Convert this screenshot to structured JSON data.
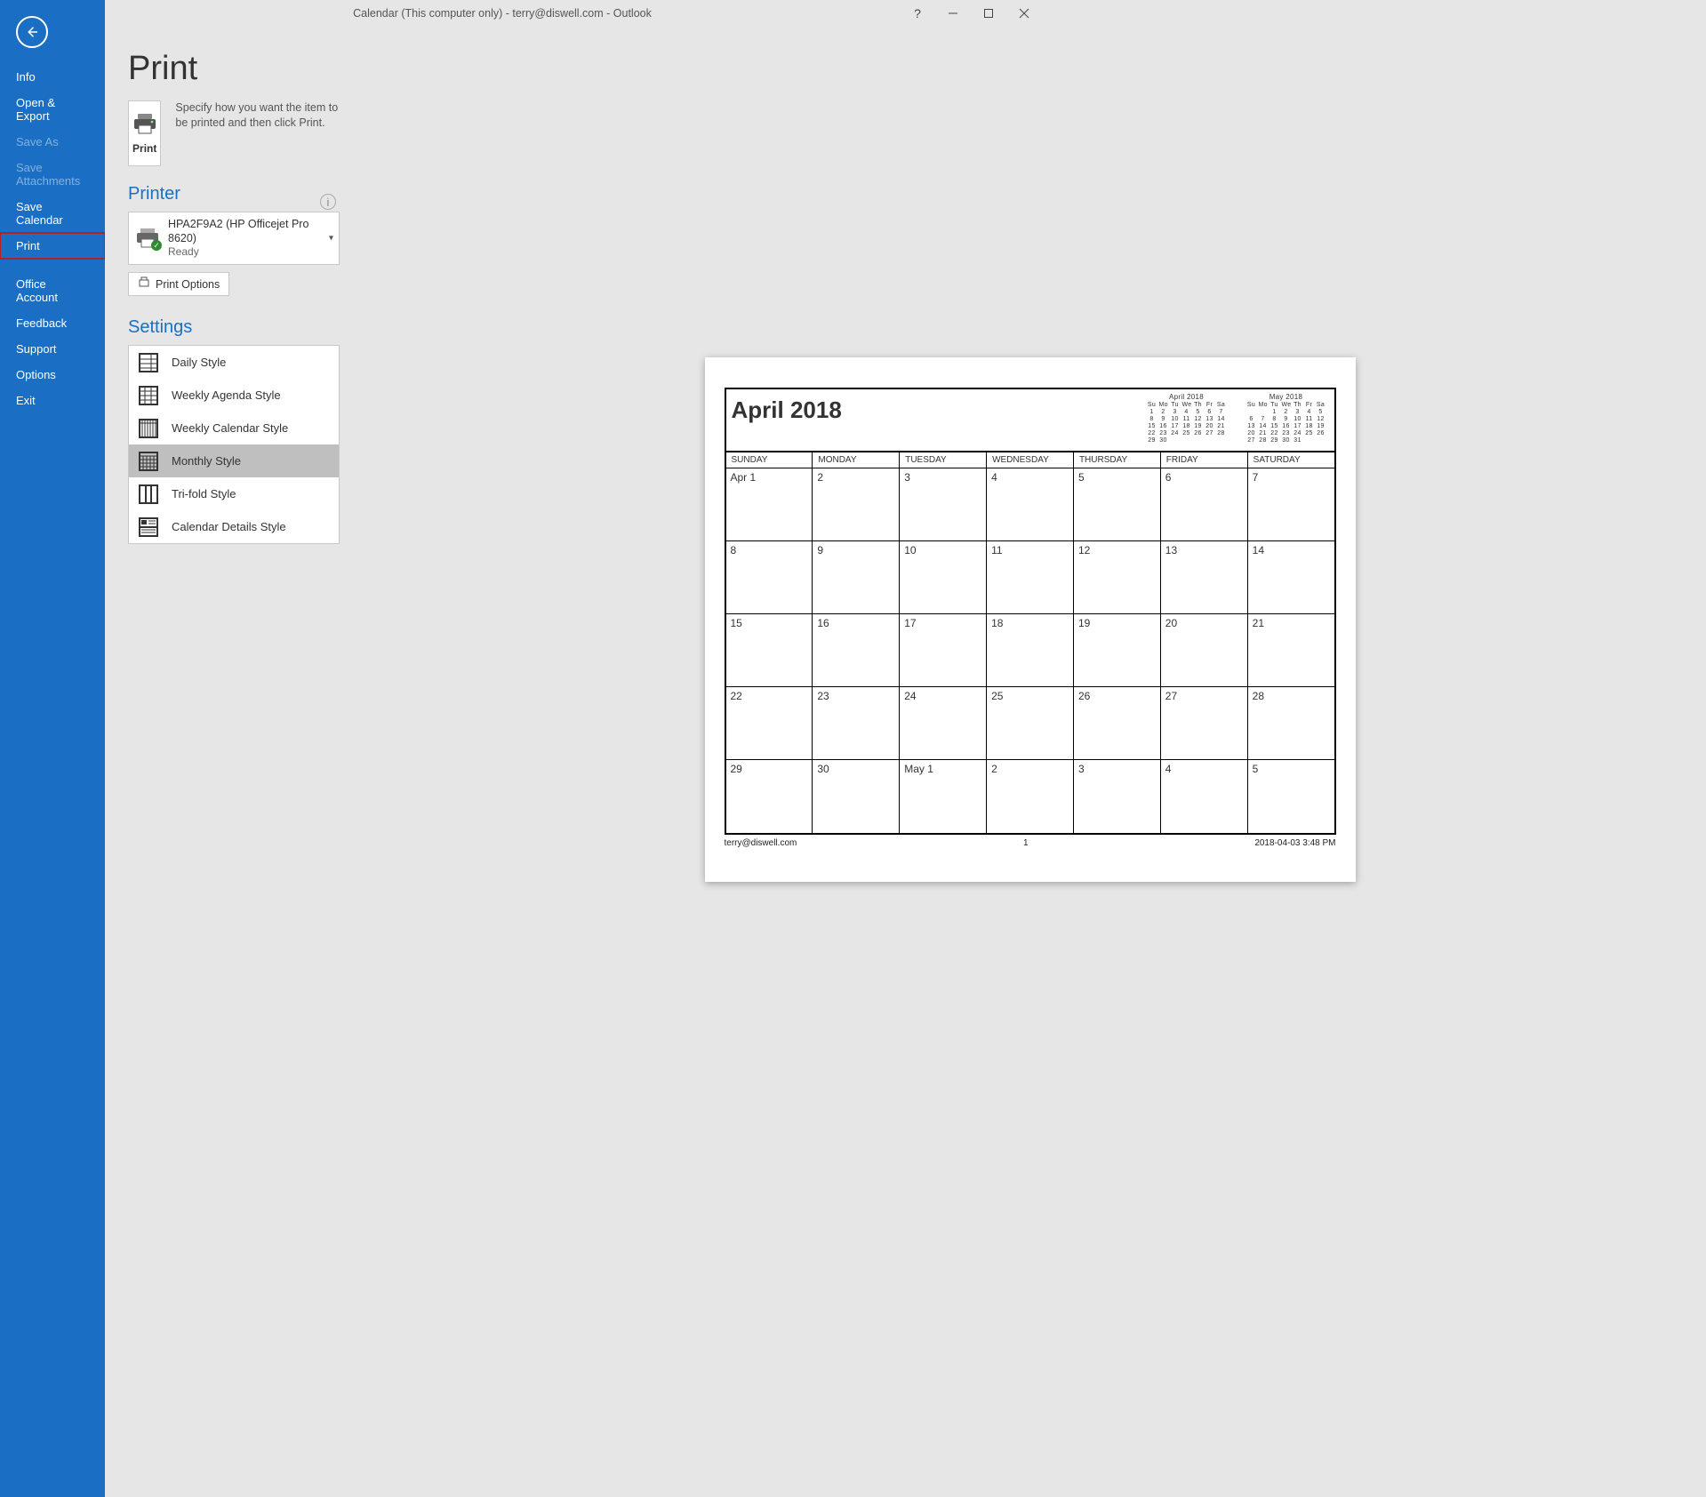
{
  "window": {
    "title": "Calendar (This computer only) - terry@diswell.com  -  Outlook"
  },
  "nav": {
    "items": [
      {
        "label": "Info",
        "disabled": false
      },
      {
        "label": "Open & Export",
        "disabled": false
      },
      {
        "label": "Save As",
        "disabled": true
      },
      {
        "label": "Save Attachments",
        "disabled": true
      },
      {
        "label": "Save Calendar",
        "disabled": false
      },
      {
        "label": "Print",
        "disabled": false,
        "selected": true
      },
      {
        "label": "Office Account",
        "disabled": false
      },
      {
        "label": "Feedback",
        "disabled": false
      },
      {
        "label": "Support",
        "disabled": false
      },
      {
        "label": "Options",
        "disabled": false
      },
      {
        "label": "Exit",
        "disabled": false
      }
    ]
  },
  "page": {
    "title": "Print",
    "print_label": "Print",
    "print_desc": "Specify how you want the item to be printed and then click Print."
  },
  "printer": {
    "section": "Printer",
    "name": "HPA2F9A2 (HP Officejet Pro 8620)",
    "status": "Ready",
    "options_btn": "Print Options"
  },
  "settings": {
    "section": "Settings",
    "styles": [
      {
        "label": "Daily Style"
      },
      {
        "label": "Weekly Agenda Style"
      },
      {
        "label": "Weekly Calendar Style"
      },
      {
        "label": "Monthly Style",
        "selected": true
      },
      {
        "label": "Tri-fold Style"
      },
      {
        "label": "Calendar Details Style"
      }
    ]
  },
  "preview": {
    "cal_title": "April 2018",
    "dow": [
      "SUNDAY",
      "MONDAY",
      "TUESDAY",
      "WEDNESDAY",
      "THURSDAY",
      "FRIDAY",
      "SATURDAY"
    ],
    "weeks": [
      [
        "Apr 1",
        "2",
        "3",
        "4",
        "5",
        "6",
        "7"
      ],
      [
        "8",
        "9",
        "10",
        "11",
        "12",
        "13",
        "14"
      ],
      [
        "15",
        "16",
        "17",
        "18",
        "19",
        "20",
        "21"
      ],
      [
        "22",
        "23",
        "24",
        "25",
        "26",
        "27",
        "28"
      ],
      [
        "29",
        "30",
        "May 1",
        "2",
        "3",
        "4",
        "5"
      ]
    ],
    "mini_a": {
      "name": "April 2018",
      "dow": [
        "Su",
        "Mo",
        "Tu",
        "We",
        "Th",
        "Fr",
        "Sa"
      ],
      "rows": [
        [
          "1",
          "2",
          "3",
          "4",
          "5",
          "6",
          "7"
        ],
        [
          "8",
          "9",
          "10",
          "11",
          "12",
          "13",
          "14"
        ],
        [
          "15",
          "16",
          "17",
          "18",
          "19",
          "20",
          "21"
        ],
        [
          "22",
          "23",
          "24",
          "25",
          "26",
          "27",
          "28"
        ],
        [
          "29",
          "30",
          "",
          "",
          "",
          "",
          ""
        ]
      ]
    },
    "mini_b": {
      "name": "May 2018",
      "dow": [
        "Su",
        "Mo",
        "Tu",
        "We",
        "Th",
        "Fr",
        "Sa"
      ],
      "rows": [
        [
          "",
          "",
          "1",
          "2",
          "3",
          "4",
          "5"
        ],
        [
          "6",
          "7",
          "8",
          "9",
          "10",
          "11",
          "12"
        ],
        [
          "13",
          "14",
          "15",
          "16",
          "17",
          "18",
          "19"
        ],
        [
          "20",
          "21",
          "22",
          "23",
          "24",
          "25",
          "26"
        ],
        [
          "27",
          "28",
          "29",
          "30",
          "31",
          "",
          ""
        ]
      ]
    },
    "footer_left": "terry@diswell.com",
    "footer_center": "1",
    "footer_right": "2018-04-03 3:48 PM"
  }
}
